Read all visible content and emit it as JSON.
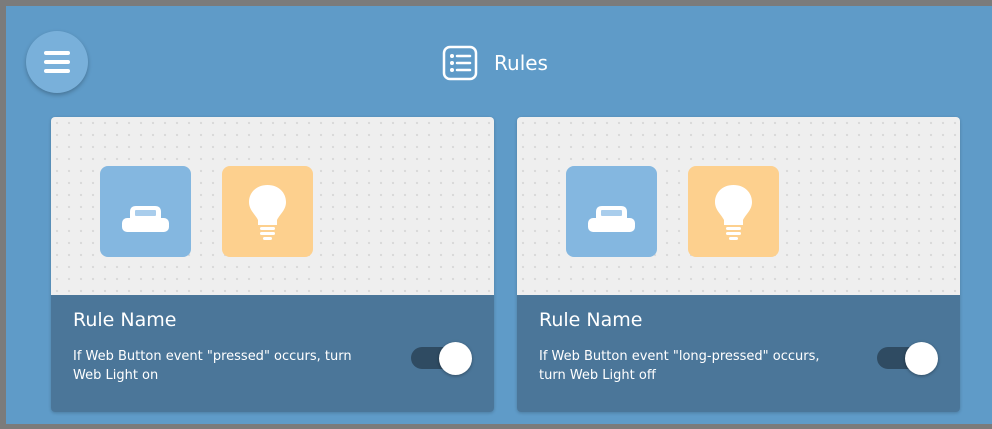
{
  "header": {
    "title": "Rules",
    "icon": "list-icon"
  },
  "menu": {
    "icon": "hamburger-icon"
  },
  "colors": {
    "background": "#5f9bc8",
    "info_panel": "#4b7699",
    "button_tile": "#84b7e0",
    "light_tile": "#fdd08e",
    "toggle_track": "#2f4b62"
  },
  "rules": [
    {
      "name": "Rule Name",
      "description": "If Web Button event \"pressed\" occurs, turn Web Light on",
      "enabled": true,
      "trigger_icon": "web-button-icon",
      "action_icon": "light-bulb-icon"
    },
    {
      "name": "Rule Name",
      "description": "If Web Button event \"long-pressed\" occurs, turn Web Light off",
      "enabled": true,
      "trigger_icon": "web-button-icon",
      "action_icon": "light-bulb-icon"
    }
  ]
}
